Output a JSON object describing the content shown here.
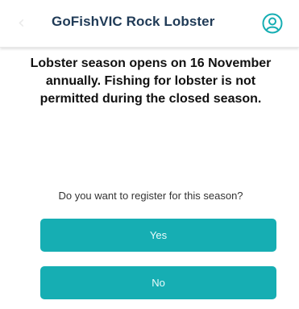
{
  "header": {
    "back_icon": "chevron-left-icon",
    "title": "GoFishVIC Rock Lobster",
    "user_icon": "user-circle-icon"
  },
  "notice": {
    "text": "Lobster season opens on 16 November annually. Fishing for lobster is not permitted during the closed season."
  },
  "register": {
    "question": "Do you want to register for this season?",
    "yes_label": "Yes",
    "no_label": "No"
  },
  "colors": {
    "accent": "#16aeb3",
    "title": "#1f3a56"
  }
}
